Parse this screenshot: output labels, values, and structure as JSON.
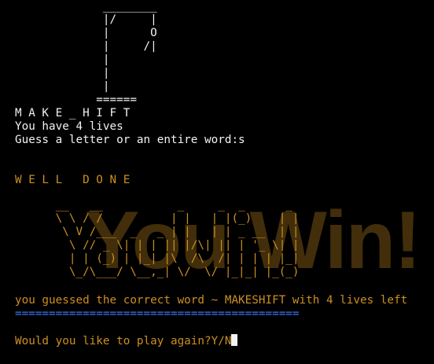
{
  "gallows": [
    "             ________",
    "             |/     |",
    "             |      O",
    "             |     /|",
    "             |",
    "             |",
    "             |",
    "            ======"
  ],
  "hidden_word": "M A K E _ H I F T",
  "lives_text": "You have 4 lives",
  "prompt_text": "Guess a letter or an entire word:s",
  "well_done": "W E L L   D O N E",
  "banner_art": [
    "      __   __           _     _  _      _",
    "      \\ \\ / /          | |   | |(_)    | |",
    "       \\ V /___  _   _ | |   | | _ __  | |",
    "        \\ // _ \\| | | || |/\\| || | '_ \\| |",
    "        | | (_) | |_| |\\  /\\  /| | | | |_|",
    "        \\_/\\___/ \\__,_| \\/  \\/ |_|_| |_(_)"
  ],
  "banner_big": "You Win!",
  "result_text": "you guessed the correct word ~ MAKESHIFT with 4 lives left",
  "separator": "==========================================",
  "play_again": "Would you like to play again?Y/N",
  "colors": {
    "background": "#000000",
    "text": "#f2f2f2",
    "accent": "#cc8f21",
    "separator": "#3b78ff"
  }
}
